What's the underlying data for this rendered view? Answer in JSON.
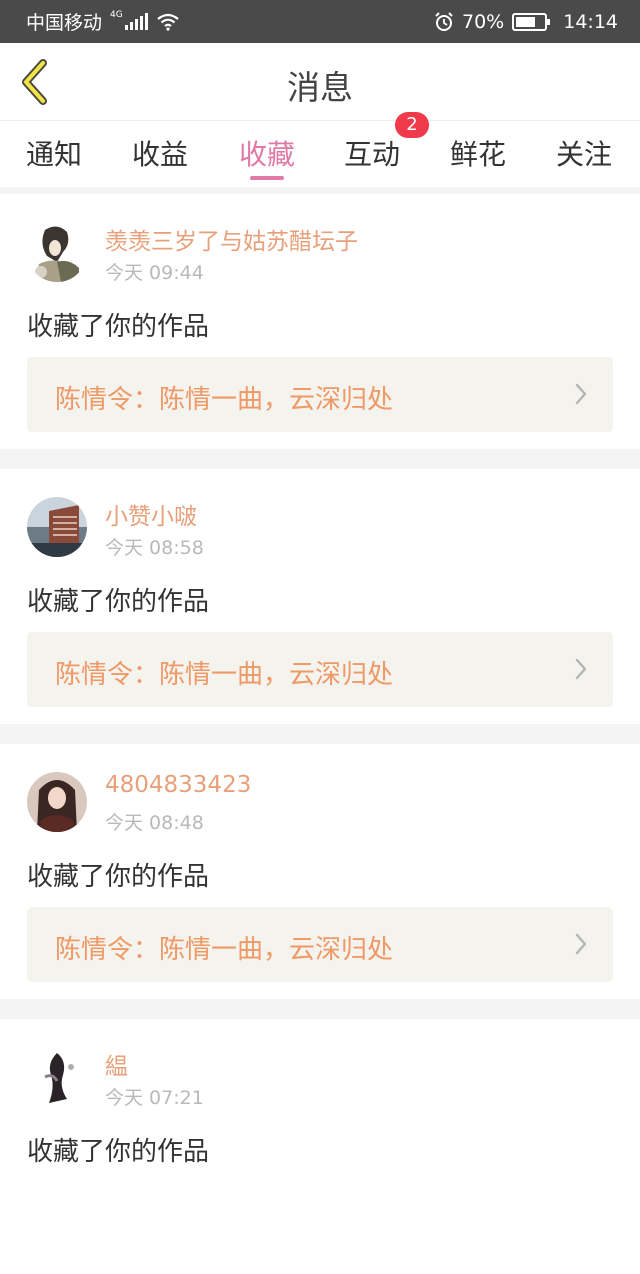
{
  "status_bar": {
    "carrier": "中国移动",
    "network": "4G",
    "battery_percent": "70%",
    "battery_level": 0.7,
    "time": "14:14"
  },
  "header": {
    "title": "消息",
    "back_icon": "chevron-left-icon"
  },
  "tabs": [
    {
      "label": "通知"
    },
    {
      "label": "收益"
    },
    {
      "label": "收藏",
      "active": true
    },
    {
      "label": "互动",
      "badge": "2"
    },
    {
      "label": "鲜花"
    },
    {
      "label": "关注"
    }
  ],
  "colors": {
    "accent": "#e07aa5",
    "username": "#e8a07a",
    "work_title": "#ee9966",
    "badge": "#f03a4b"
  },
  "messages": [
    {
      "user": "羡羡三岁了与姑苏醋坛子",
      "time": "今天 09:44",
      "action": "收藏了你的作品",
      "work": "陈情令：陈情一曲，云深归处"
    },
    {
      "user": "小赞小啵",
      "time": "今天 08:58",
      "action": "收藏了你的作品",
      "work": "陈情令：陈情一曲，云深归处"
    },
    {
      "user": "4804833423",
      "time": "今天 08:48",
      "action": "收藏了你的作品",
      "work": "陈情令：陈情一曲，云深归处"
    },
    {
      "user": "緼",
      "time": "今天 07:21",
      "action": "收藏了你的作品",
      "work": ""
    }
  ]
}
